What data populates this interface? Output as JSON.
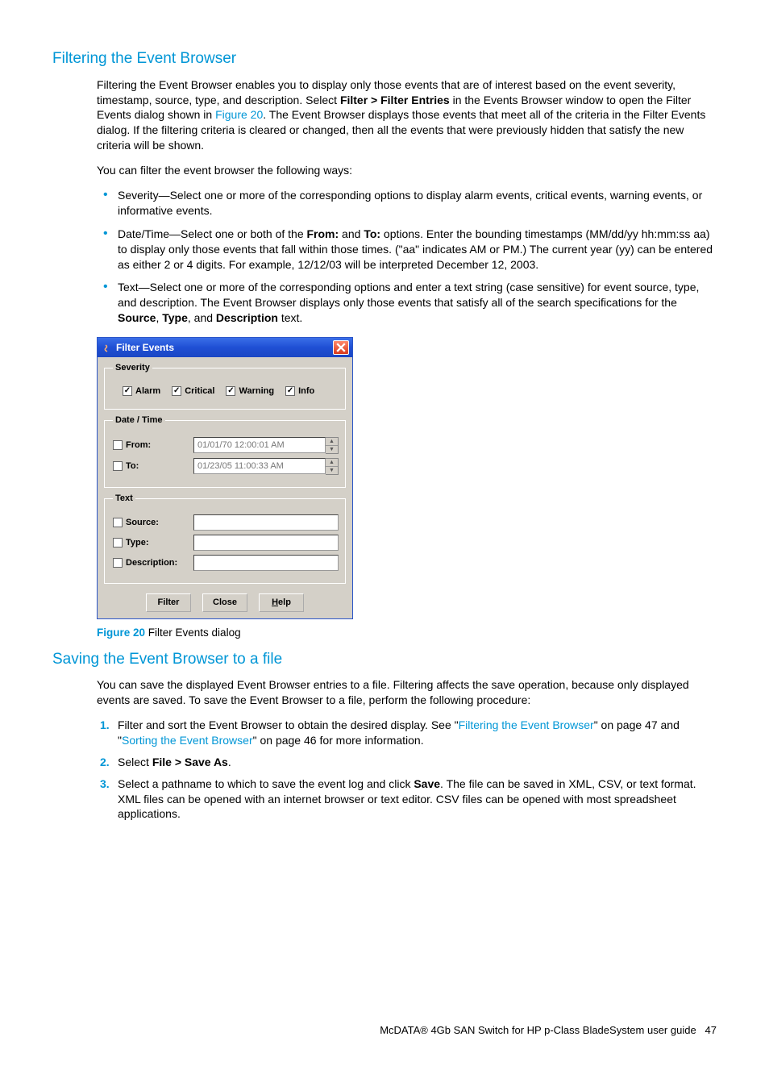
{
  "section1": {
    "title": "Filtering the Event Browser",
    "para1_parts": {
      "a": "Filtering the Event Browser enables you to display only those events that are of interest based on the event severity, timestamp, source, type, and description. Select ",
      "b": "Filter > Filter Entries",
      "c": " in the Events Browser window to open the Filter Events dialog shown in ",
      "d": "Figure 20",
      "e": ". The Event Browser displays those events that meet all of the criteria in the Filter Events dialog. If the filtering criteria is cleared or changed, then all the events that were previously hidden that satisfy the new criteria will be shown."
    },
    "para2": "You can filter the event browser the following ways:",
    "bullets": {
      "b1": "Severity—Select one or more of the corresponding options to display alarm events, critical events, warning events, or informative events.",
      "b2": {
        "a": "Date/Time—Select one or both of the ",
        "from": "From:",
        "mid": " and ",
        "to": "To:",
        "b": " options. Enter the bounding timestamps (MM/dd/yy hh:mm:ss aa) to display only those events that fall within those times. (\"aa\" indicates AM or PM.) The current year (yy) can be entered as either 2 or 4 digits. For example, 12/12/03 will be interpreted December 12, 2003."
      },
      "b3": {
        "a": "Text—Select one or more of the corresponding options and enter a text string (case sensitive) for event source, type, and description. The Event Browser displays only those events that satisfy all of the search specifications for the ",
        "source": "Source",
        "c1": ", ",
        "type": "Type",
        "c2": ", and ",
        "desc": "Description",
        "b": " text."
      }
    }
  },
  "dialog": {
    "title": "Filter Events",
    "severity": {
      "legend": "Severity",
      "alarm": "Alarm",
      "critical": "Critical",
      "warning": "Warning",
      "info": "Info"
    },
    "datetime": {
      "legend": "Date / Time",
      "from_label": "From:",
      "from_value": "01/01/70 12:00:01 AM",
      "to_label": "To:",
      "to_value": "01/23/05 11:00:33 AM"
    },
    "text": {
      "legend": "Text",
      "source": "Source:",
      "type": "Type:",
      "description": "Description:"
    },
    "buttons": {
      "filter": "Filter",
      "close": "Close",
      "help_h": "H",
      "help_elp": "elp"
    }
  },
  "figure": {
    "num": "Figure 20",
    "caption": " Filter Events dialog"
  },
  "section2": {
    "title": "Saving the Event Browser to a file",
    "para1": "You can save the displayed Event Browser entries to a file. Filtering affects the save operation, because only displayed events are saved. To save the Event Browser to a file, perform the following procedure:",
    "steps": {
      "s1": {
        "a": "Filter and sort the Event Browser to obtain the desired display. See \"",
        "link1": "Filtering the Event Browser",
        "b": "\" on page 47 and \"",
        "link2": "Sorting the Event Browser",
        "c": "\" on page 46 for more information."
      },
      "s2": {
        "a": "Select ",
        "bold": "File > Save As",
        "b": "."
      },
      "s3": {
        "a": "Select a pathname to which to save the event log and click ",
        "bold": "Save",
        "b": ". The file can be saved in XML, CSV, or text format. XML files can be opened with an internet browser or text editor. CSV files can be opened with most spreadsheet applications."
      }
    }
  },
  "footer": {
    "text": "McDATA® 4Gb SAN Switch for HP p-Class BladeSystem user guide",
    "page": "47"
  }
}
